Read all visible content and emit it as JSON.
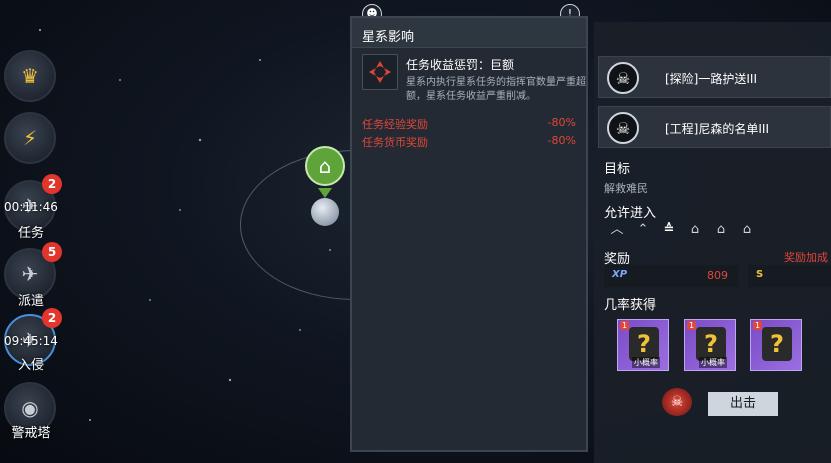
{
  "left_menu": {
    "items": [
      {
        "label": "任务",
        "timer": "00:11:46",
        "badge": "2"
      },
      {
        "label": "派遣",
        "timer": "",
        "badge": "5"
      },
      {
        "label": "入侵",
        "timer": "09:45:14",
        "badge": "2"
      },
      {
        "label": "警戒塔",
        "timer": "",
        "badge": ""
      }
    ]
  },
  "popup": {
    "title": "星系影响",
    "effect_title": "任务收益惩罚：巨额",
    "effect_desc": "星系内执行星系任务的指挥官数量严重超额，星系任务收益严重削减。",
    "penalties": [
      {
        "label": "任务经验奖励",
        "value": "-80%"
      },
      {
        "label": "任务货币奖励",
        "value": "-80%"
      }
    ]
  },
  "right_panel": {
    "missions": [
      "[探险]一路护送III",
      "[工程]尼森的名单III"
    ],
    "target_label": "目标",
    "target_value": "解救难民",
    "allowed_label": "允许进入",
    "tiers": [
      "︿",
      "⌃",
      "≙",
      "⌂",
      "⌂",
      "⌂"
    ],
    "reward_label": "奖励",
    "reward_bonus": "奖励加成",
    "xp_label": "XP",
    "xp_value": "809",
    "s_label": "S",
    "chance_label": "几率获得",
    "cards": [
      {
        "badge": "1",
        "small": "小概率"
      },
      {
        "badge": "1",
        "small": "小概率"
      },
      {
        "badge": "1",
        "small": ""
      }
    ],
    "go_label": "出击"
  },
  "colors": {
    "penalty": "#e0463a",
    "card": "#8a5cd4",
    "badge": "#e2362d",
    "accent": "#f0c23a"
  }
}
